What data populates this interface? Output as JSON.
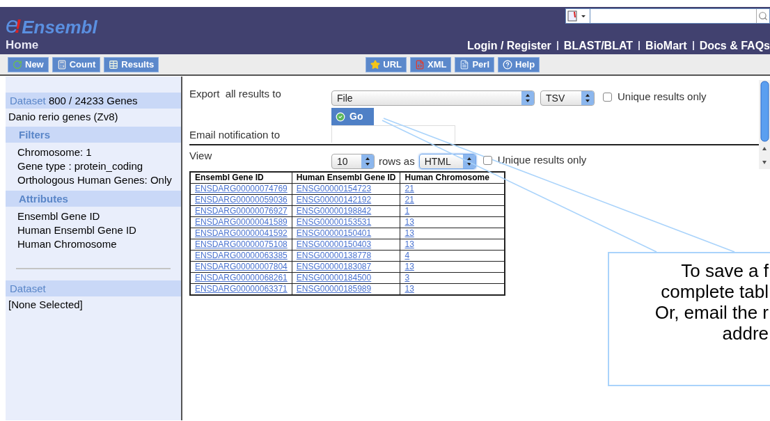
{
  "header": {
    "logo": {
      "letter": "e",
      "mark": "!",
      "name": "Ensembl"
    },
    "page_title": "Home",
    "nav_links": [
      "Login / Register",
      "BLAST/BLAT",
      "BioMart",
      "Docs & FAQs"
    ]
  },
  "toolbar": {
    "left": [
      {
        "label": "New",
        "kind": "refresh"
      },
      {
        "label": "Count",
        "kind": "calculator"
      },
      {
        "label": "Results",
        "kind": "table"
      }
    ],
    "right": [
      {
        "label": "URL",
        "kind": "star"
      },
      {
        "label": "XML",
        "kind": "code"
      },
      {
        "label": "Perl",
        "kind": "script"
      },
      {
        "label": "Help",
        "kind": "help"
      }
    ]
  },
  "sidebar": {
    "sections": [
      {
        "kind": "head",
        "title": "Dataset",
        "subtitle": "800 / 24233 Genes"
      },
      {
        "kind": "text",
        "lines": [
          "Danio rerio genes (Zv8)"
        ]
      },
      {
        "kind": "sub",
        "title": "Filters"
      },
      {
        "kind": "items",
        "lines": [
          "Chromosome: 1",
          "Gene type : protein_coding",
          "Orthologous Human Genes: Only"
        ]
      },
      {
        "kind": "sub",
        "title": "Attributes"
      },
      {
        "kind": "items",
        "lines": [
          "Ensembl Gene ID",
          "Human Ensembl Gene ID",
          "Human Chromosome"
        ]
      },
      {
        "kind": "rule"
      },
      {
        "kind": "head",
        "title": "Dataset"
      },
      {
        "kind": "text",
        "lines": [
          "[None Selected]"
        ]
      }
    ]
  },
  "export": {
    "label": "Export  all results to",
    "destination": "File",
    "format": "TSV",
    "unique": {
      "label": "Unique results only",
      "checked": false
    },
    "go": "Go"
  },
  "email": {
    "label": "Email notification to"
  },
  "view": {
    "label": "View",
    "rows": "10",
    "rows_as": "rows as",
    "format": "HTML",
    "unique": {
      "label": "Unique results only",
      "checked": false
    }
  },
  "table": {
    "columns": [
      "Ensembl Gene ID",
      "Human Ensembl Gene ID",
      "Human Chromosome"
    ],
    "rows": [
      [
        "ENSDARG00000074769",
        "ENSG00000154723",
        "21"
      ],
      [
        "ENSDARG00000059036",
        "ENSG00000142192",
        "21"
      ],
      [
        "ENSDARG00000076927",
        "ENSG00000198842",
        "1"
      ],
      [
        "ENSDARG00000041589",
        "ENSG00000153531",
        "13"
      ],
      [
        "ENSDARG00000041592",
        "ENSG00000150401",
        "13"
      ],
      [
        "ENSDARG00000075108",
        "ENSG00000150403",
        "13"
      ],
      [
        "ENSDARG00000063385",
        "ENSG00000138778",
        "4"
      ],
      [
        "ENSDARG00000007804",
        "ENSG00000183087",
        "13"
      ],
      [
        "ENSDARG00000068261",
        "ENSG00000184500",
        "3"
      ],
      [
        "ENSDARG00000063371",
        "ENSG00000185989",
        "13"
      ]
    ]
  },
  "callout": {
    "lines": [
      "To save a f",
      "complete tabl",
      "Or, email the r",
      "addre"
    ]
  }
}
